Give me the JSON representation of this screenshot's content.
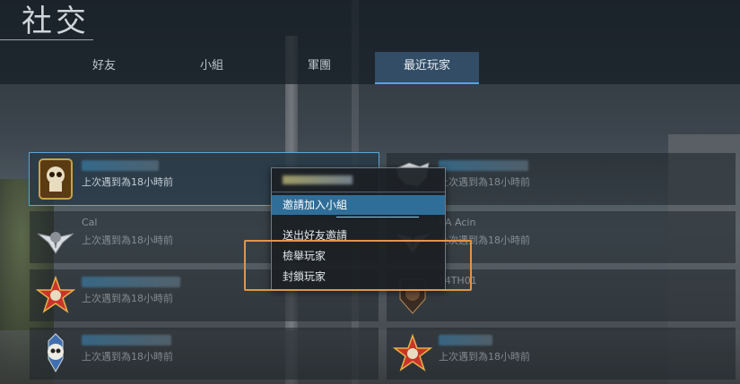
{
  "header": {
    "title": "社交"
  },
  "tabs": [
    {
      "label": "好友"
    },
    {
      "label": "小組"
    },
    {
      "label": "軍團"
    },
    {
      "label": "最近玩家",
      "active": true
    }
  ],
  "players_left": [
    {
      "name": "",
      "last_seen": "上次遇到為18小時前",
      "emblem": "skull-emblem-icon",
      "selected": true
    },
    {
      "name": "Cal",
      "last_seen": "上次遇到為18小時前",
      "emblem": "wings-emblem-icon"
    },
    {
      "name": "",
      "last_seen": "上次遇到為18小時前",
      "emblem": "star-emblem-icon"
    },
    {
      "name": "",
      "last_seen": "上次遇到為18小時前",
      "emblem": "skull-knife-emblem-icon"
    }
  ],
  "players_right": [
    {
      "name": "",
      "last_seen": "上次遇到為18小時前",
      "emblem": "beast-emblem-icon"
    },
    {
      "name": "KA Acin",
      "last_seen": "上次遇到為18小時前",
      "emblem": "wings-emblem-icon"
    },
    {
      "name": "T4TH01",
      "last_seen": "",
      "emblem": "shield-emblem-icon"
    },
    {
      "name": "",
      "last_seen": "上次遇到為18小時前",
      "emblem": "star-emblem-icon"
    }
  ],
  "context_menu": {
    "items": [
      {
        "label": "邀請加入小組",
        "highlight": true
      },
      {
        "label": "送出好友邀請"
      },
      {
        "label": "檢舉玩家"
      },
      {
        "label": "封鎖玩家"
      }
    ]
  },
  "colors": {
    "accent": "#4aa8e6",
    "highlight": "#2f6e99",
    "annotation": "#e0954a"
  }
}
